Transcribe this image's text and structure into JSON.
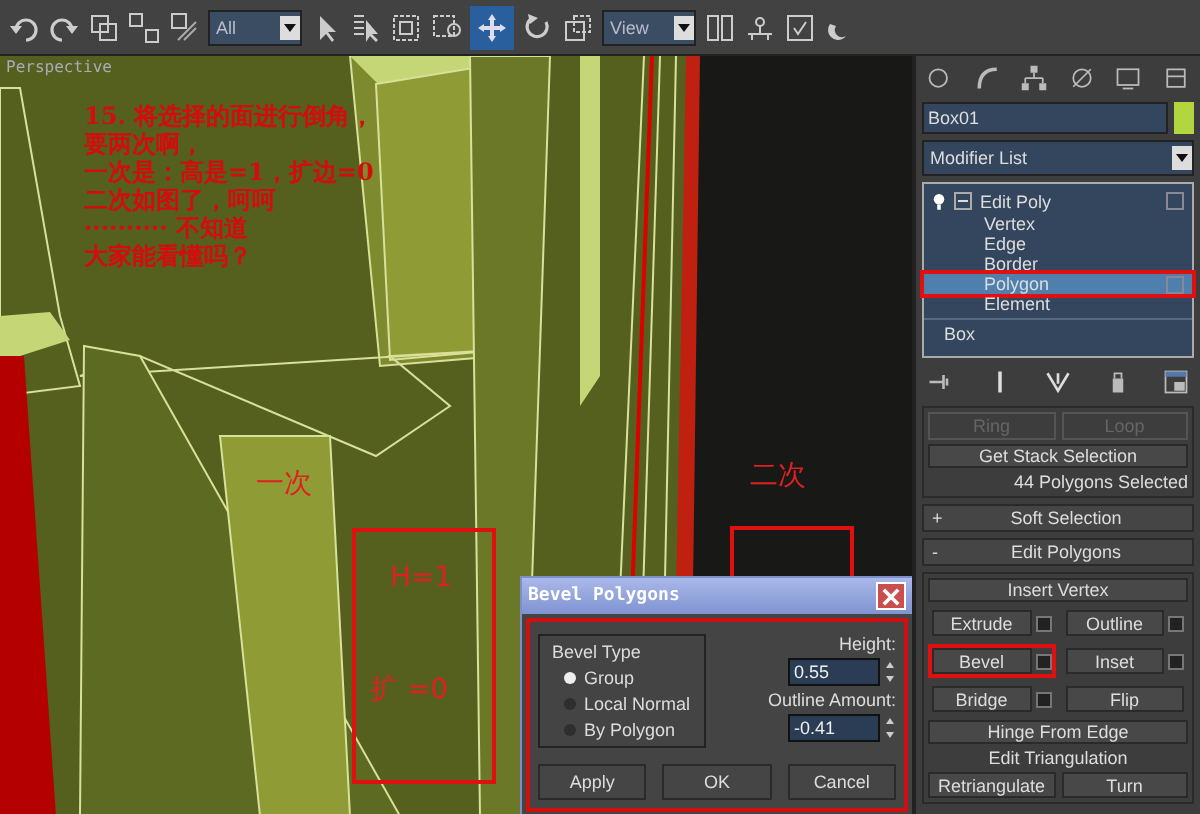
{
  "toolbar": {
    "selection_filter": "All",
    "reference_coord": "View"
  },
  "viewport": {
    "label": "Perspective",
    "note_lines": [
      "15. 将选择的面进行倒角，",
      "要两次啊，",
      "一次是：高是=1，扩边=0",
      "二次如图了，呵呵",
      "·········· 不知道",
      "大家能看懂吗？"
    ],
    "annotations": [
      {
        "text": "一次",
        "kind": "label"
      },
      {
        "text": "H=1",
        "kind": "label"
      },
      {
        "text": "扩 =0",
        "kind": "label"
      },
      {
        "text": "二次",
        "kind": "label"
      }
    ]
  },
  "dialog": {
    "title": "Bevel Polygons",
    "group_title": "Bevel Type",
    "options": [
      {
        "label": "Group",
        "selected": true
      },
      {
        "label": "Local Normal",
        "selected": false
      },
      {
        "label": "By Polygon",
        "selected": false
      }
    ],
    "fields": [
      {
        "label": "Height:",
        "value": "0.55"
      },
      {
        "label": "Outline Amount:",
        "value": "-0.41"
      }
    ],
    "buttons": [
      "Apply",
      "OK",
      "Cancel"
    ]
  },
  "command_panel": {
    "object_name": "Box01",
    "modifier_list": "Modifier List",
    "stack": [
      {
        "label": "Edit Poly",
        "expanded": true,
        "children": [
          {
            "label": "Vertex",
            "selected": false
          },
          {
            "label": "Edge",
            "selected": false
          },
          {
            "label": "Border",
            "selected": false
          },
          {
            "label": "Polygon",
            "selected": true
          },
          {
            "label": "Element",
            "selected": false
          }
        ]
      },
      {
        "label": "Box",
        "expanded": false
      }
    ],
    "spinners": [
      {
        "label": "Ring",
        "disabled": true
      },
      {
        "label": "Loop",
        "disabled": true
      }
    ],
    "stack_selection_button": "Get Stack Selection",
    "selection_info": "44 Polygons Selected",
    "rollouts": [
      {
        "sign": "+",
        "label": "Soft Selection"
      },
      {
        "sign": "-",
        "label": "Edit Polygons"
      }
    ],
    "insert_button": "Insert Vertex",
    "button_rows": [
      [
        {
          "label": "Extrude",
          "settings": true,
          "highlighted": false
        },
        {
          "label": "Outline",
          "settings": true,
          "highlighted": false
        }
      ],
      [
        {
          "label": "Bevel",
          "settings": true,
          "highlighted": true
        },
        {
          "label": "Inset",
          "settings": true,
          "highlighted": false
        }
      ],
      [
        {
          "label": "Bridge",
          "settings": true,
          "highlighted": false
        },
        {
          "label": "Flip",
          "settings": false,
          "highlighted": false
        }
      ]
    ],
    "hinge_button": "Hinge From Edge",
    "triangulation_button": "Edit Triangulation",
    "bottom_buttons": [
      "Retriangulate",
      "Turn"
    ]
  }
}
